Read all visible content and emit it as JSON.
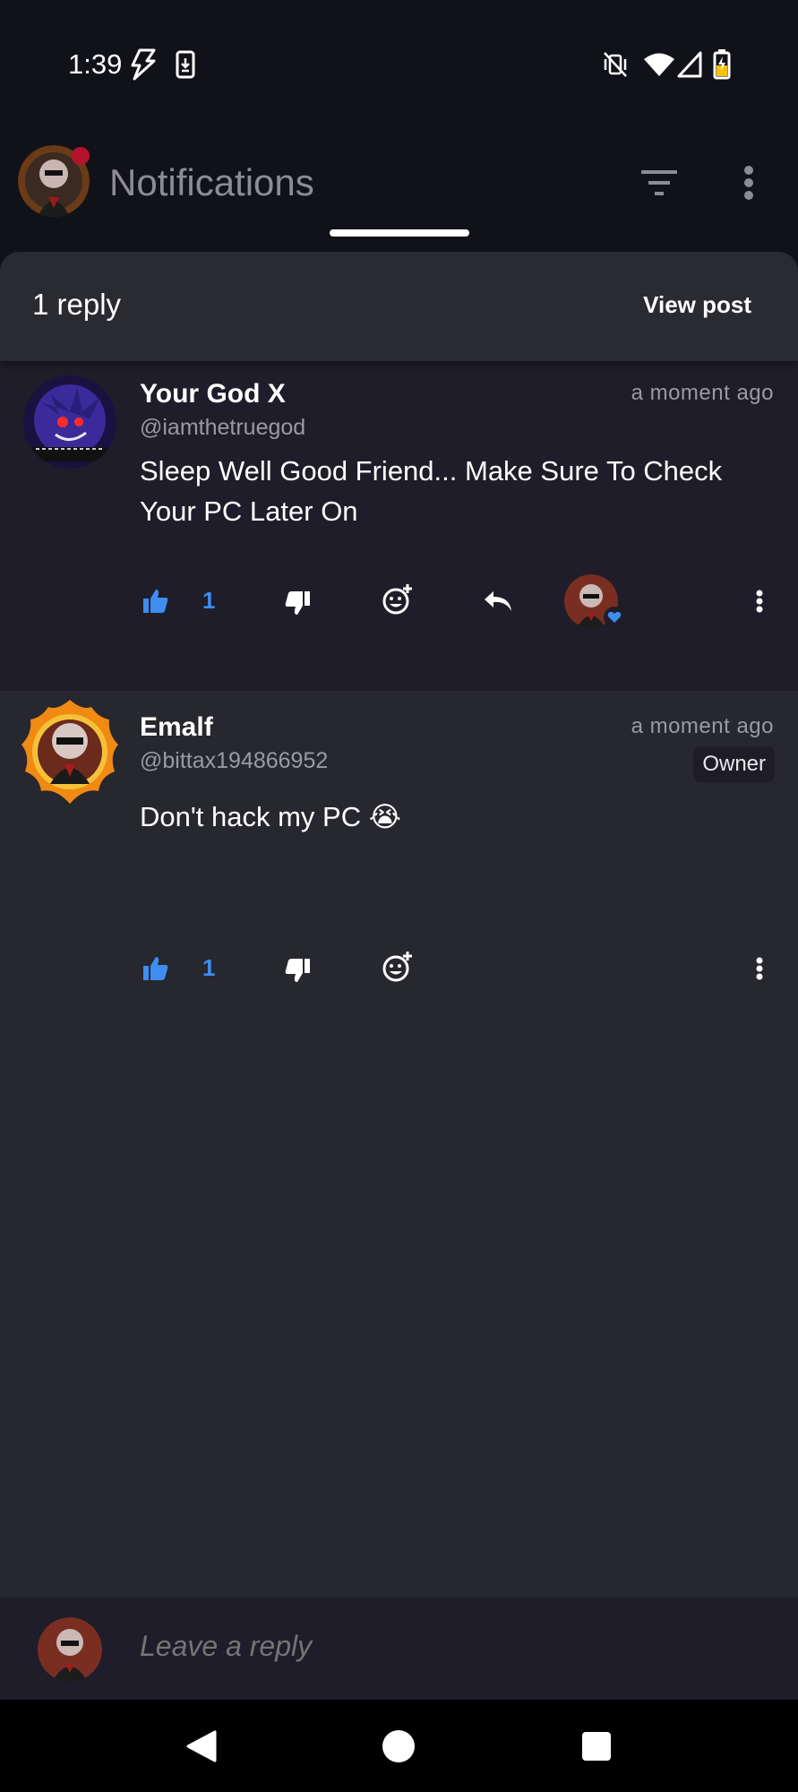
{
  "status_bar": {
    "time": "1:39",
    "icons": [
      "flash-icon",
      "download-icon",
      "vibrate-off-icon",
      "wifi-icon",
      "signal-icon",
      "battery-charging-icon"
    ]
  },
  "header": {
    "title": "Notifications",
    "icons": [
      "filter-icon",
      "more-vertical-icon"
    ]
  },
  "sheet": {
    "reply_count": "1 reply",
    "view_post_label": "View post"
  },
  "comments": [
    {
      "username": "Your God X",
      "handle": "@iamthetruegod",
      "timestamp": "a moment ago",
      "text": "Sleep Well Good Friend... Make Sure To Check Your PC Later On",
      "likes": "1",
      "liked_by_author": true
    },
    {
      "username": "Emalf",
      "handle": "@bittax194866952",
      "timestamp": "a moment ago",
      "badge": "Owner",
      "text": "Don't hack my PC 😭",
      "likes": "1"
    }
  ],
  "reply_input": {
    "placeholder": "Leave a reply"
  },
  "colors": {
    "background": "#111219",
    "sheet": "#27272f",
    "parent_comment": "#1e1d29",
    "accent_blue": "#3d8ef0",
    "muted_text": "#9a9aa3"
  },
  "nav": {
    "icons": [
      "back-icon",
      "home-icon",
      "recents-icon"
    ]
  }
}
